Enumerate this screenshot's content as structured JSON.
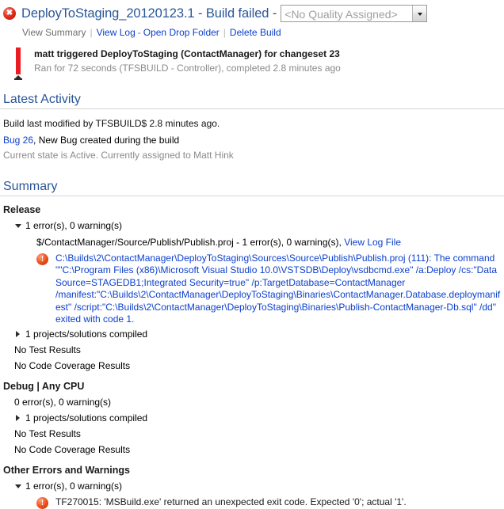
{
  "header": {
    "status_icon": "build-failed-icon",
    "title": "DeployToStaging_20120123.1 - Build failed -",
    "quality": {
      "selected": "<No Quality Assigned>",
      "dropdown_icon": "chevron-down-icon"
    }
  },
  "commands": {
    "view_summary": "View Summary",
    "view_log": "View Log",
    "open_drop_folder": "Open Drop Folder",
    "delete_build": "Delete Build",
    "dash": "-"
  },
  "trigger": {
    "line1": "matt triggered DeployToStaging (ContactManager) for changeset 23",
    "line2": "Ran for 72 seconds (TFSBUILD - Controller), completed 2.8 minutes ago"
  },
  "latest_activity": {
    "heading": "Latest Activity",
    "modified": "Build last modified by TFSBUILD$ 2.8 minutes ago.",
    "bug_link": "Bug 26",
    "bug_rest": ", New Bug created during the build",
    "bug_state": "Current state is Active. Currently assigned to Matt Hink"
  },
  "summary": {
    "heading": "Summary",
    "configurations": [
      {
        "name": "Release",
        "counts": "1 error(s), 0 warning(s)",
        "expanded": true,
        "project": {
          "text": "$/ContactManager/Source/Publish/Publish.proj - 1 error(s), 0 warning(s),",
          "link": "View Log File"
        },
        "errors": [
          {
            "icon": "error-icon",
            "color": "blue",
            "text": "C:\\Builds\\2\\ContactManager\\DeployToStaging\\Sources\\Source\\Publish\\Publish.proj (111): The command \"\"C:\\Program Files (x86)\\Microsoft Visual Studio 10.0\\VSTSDB\\Deploy\\vsdbcmd.exe\" /a:Deploy /cs:\"Data Source=STAGEDB1;Integrated Security=true\" /p:TargetDatabase=ContactManager /manifest:\"C:\\Builds\\2\\ContactManager\\DeployToStaging\\Binaries\\ContactManager.Database.deploymanifest\" /script:\"C:\\Builds\\2\\ContactManager\\DeployToStaging\\Binaries\\Publish-ContactManager-Db.sql\" /dd\" exited with code 1."
          }
        ],
        "compiled": "1 projects/solutions compiled",
        "test_results": "No Test Results",
        "coverage_results": "No Code Coverage Results"
      },
      {
        "name": "Debug | Any CPU",
        "counts": "0 error(s), 0 warning(s)",
        "expanded": false,
        "compiled": "1 projects/solutions compiled",
        "test_results": "No Test Results",
        "coverage_results": "No Code Coverage Results"
      }
    ],
    "other": {
      "name": "Other Errors and Warnings",
      "counts": "1 error(s), 0 warning(s)",
      "error": {
        "icon": "error-icon",
        "color": "black",
        "text": "TF270015: 'MSBuild.exe' returned an unexpected exit code. Expected '0'; actual '1'."
      }
    }
  },
  "colors": {
    "heading_blue": "#2a5699",
    "link_blue": "#0b3fcd",
    "error_red": "#ec1c24",
    "muted_grey": "#8a8a8a"
  }
}
